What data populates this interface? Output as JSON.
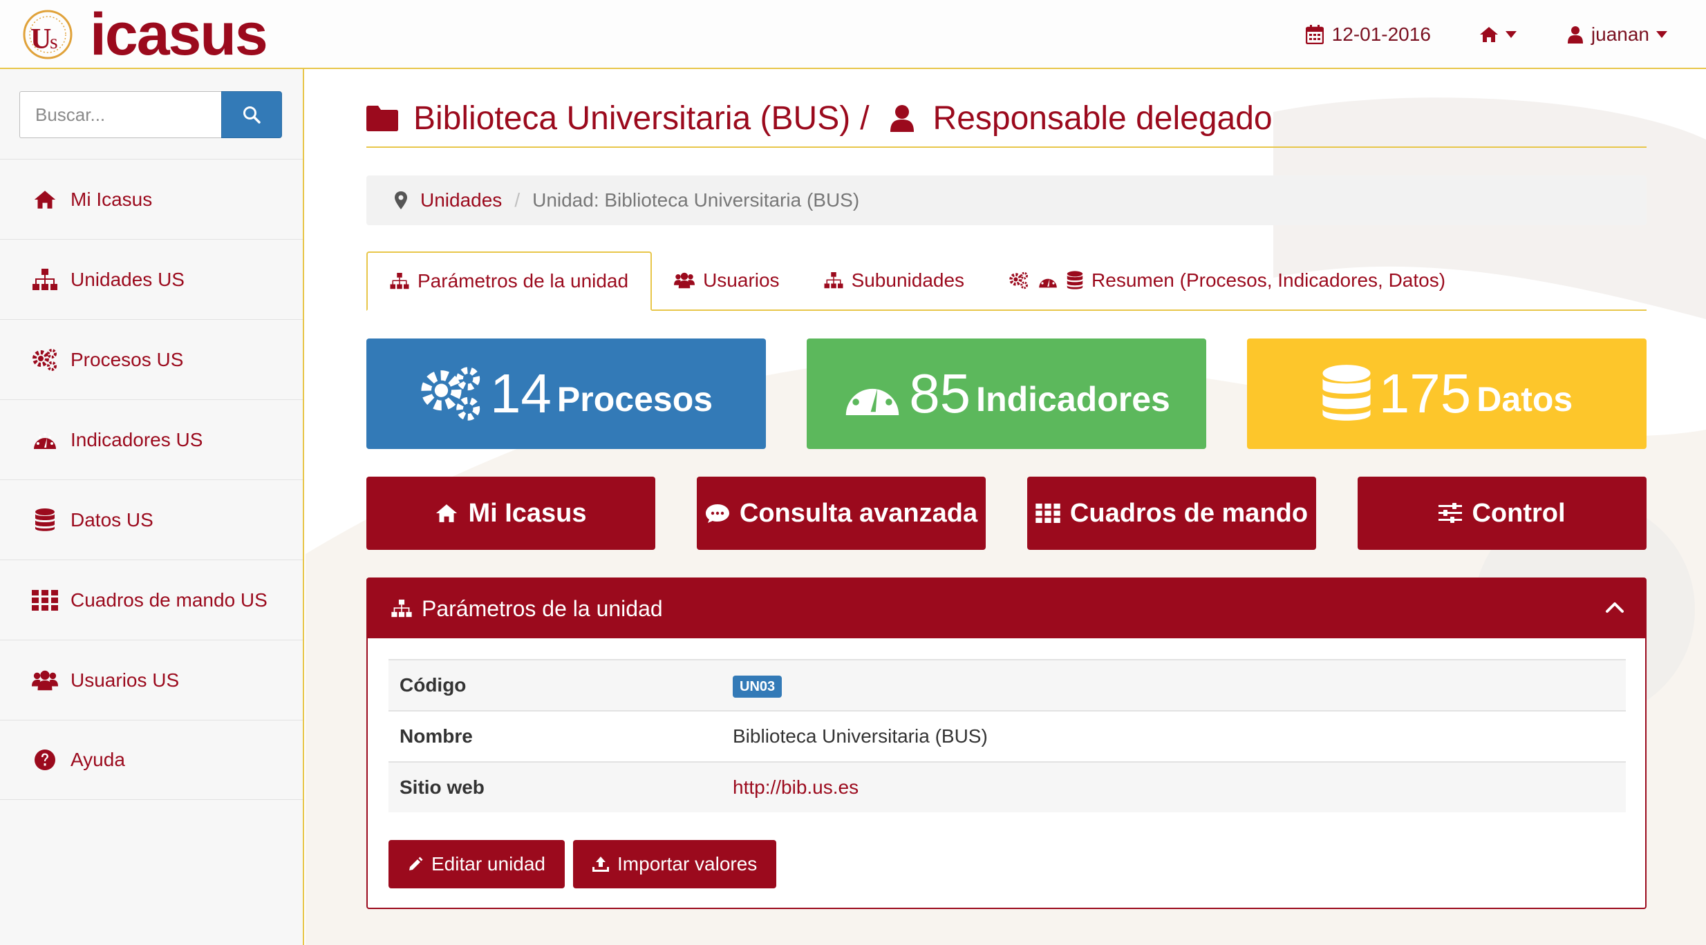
{
  "brand": {
    "name": "icasus"
  },
  "navbar": {
    "date": "12-01-2016",
    "user": "juanan"
  },
  "search": {
    "placeholder": "Buscar..."
  },
  "sidebar": {
    "items": [
      {
        "label": "Mi Icasus",
        "icon": "home-icon"
      },
      {
        "label": "Unidades US",
        "icon": "sitemap-icon"
      },
      {
        "label": "Procesos US",
        "icon": "cogs-icon"
      },
      {
        "label": "Indicadores US",
        "icon": "dashboard-icon"
      },
      {
        "label": "Datos US",
        "icon": "database-icon"
      },
      {
        "label": "Cuadros de mando US",
        "icon": "grid-icon"
      },
      {
        "label": "Usuarios US",
        "icon": "users-icon"
      },
      {
        "label": "Ayuda",
        "icon": "question-icon"
      }
    ]
  },
  "header": {
    "unit": "Biblioteca Universitaria (BUS)",
    "separator": "/",
    "role": "Responsable delegado"
  },
  "breadcrumb": {
    "link": "Unidades",
    "separator": "/",
    "current": "Unidad: Biblioteca Universitaria (BUS)"
  },
  "tabs": [
    {
      "label": "Parámetros de la unidad",
      "active": true
    },
    {
      "label": "Usuarios",
      "active": false
    },
    {
      "label": "Subunidades",
      "active": false
    },
    {
      "label": "Resumen (Procesos, Indicadores, Datos)",
      "active": false
    }
  ],
  "tiles": [
    {
      "count": "14",
      "label": "Procesos",
      "color": "#337ab7"
    },
    {
      "count": "85",
      "label": "Indicadores",
      "color": "#5cb85c"
    },
    {
      "count": "175",
      "label": "Datos",
      "color": "#fdc62b"
    }
  ],
  "actions": [
    {
      "label": "Mi Icasus"
    },
    {
      "label": "Consulta avanzada"
    },
    {
      "label": "Cuadros de mando"
    },
    {
      "label": "Control"
    }
  ],
  "panel": {
    "title": "Parámetros de la unidad",
    "rows": [
      {
        "key": "Código",
        "value": "UN03"
      },
      {
        "key": "Nombre",
        "value": "Biblioteca Universitaria (BUS)"
      },
      {
        "key": "Sitio web",
        "value": "http://bib.us.es"
      }
    ],
    "buttons": {
      "edit": "Editar unidad",
      "import": "Importar valores"
    }
  },
  "colors": {
    "brand": "#9b0a1d",
    "accent": "#e8c64a",
    "primary": "#337ab7",
    "success": "#5cb85c",
    "warning": "#fdc62b"
  }
}
